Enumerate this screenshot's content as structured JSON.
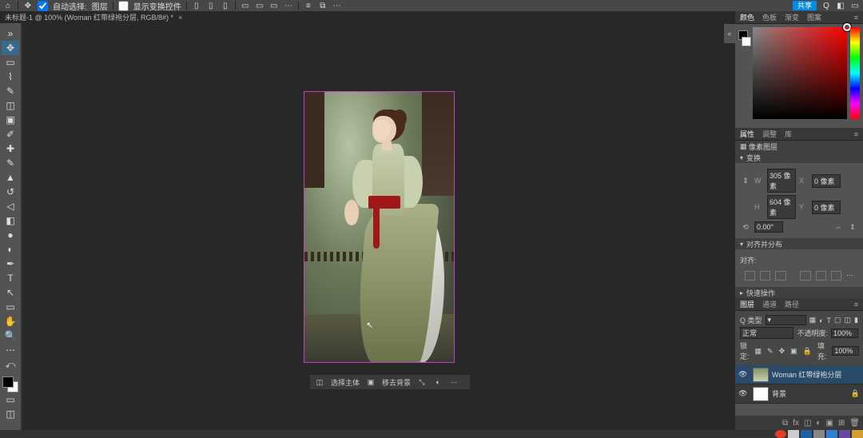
{
  "topbar": {
    "home_icon": "home",
    "auto_select_label": "自动选择:",
    "auto_select_value": "图层",
    "show_controls_label": "显示变换控件",
    "share_label": "共享"
  },
  "tab": {
    "title": "未标题-1 @ 100% (Woman 红带绿袍分层, RGB/8#) *",
    "close": "×"
  },
  "selbar": {
    "select_subject": "选择主体",
    "remove_bg": "移去背景"
  },
  "rightcol_toggle": "«",
  "color_panel": {
    "tabs": [
      "颜色",
      "色板",
      "渐变",
      "图案"
    ],
    "active": 0
  },
  "props_panel": {
    "tabs": [
      "属性",
      "调整",
      "库"
    ],
    "active": 0,
    "title_icon": "pixel-layer",
    "title": "像素图层",
    "section_transform": "变换",
    "w_label": "W",
    "w_value": "305 像素",
    "x_label": "X",
    "x_value": "0 像素",
    "h_label": "H",
    "h_value": "604 像素",
    "y_label": "Y",
    "y_value": "0 像素",
    "rotate_value": "0.00°",
    "section_align": "对齐并分布",
    "align_label": "对齐:",
    "section_more": "快速操作"
  },
  "layers_panel": {
    "tabs": [
      "图层",
      "通道",
      "路径"
    ],
    "active": 0,
    "kind_label": "Q 类型",
    "blend_label": "正常",
    "opacity_label": "不透明度:",
    "opacity_value": "100%",
    "lock_label": "锁定:",
    "fill_label": "填充:",
    "fill_value": "100%",
    "layers": [
      {
        "visible": true,
        "name": "Woman 红带绿袍分层",
        "selected": true,
        "thumb": "img"
      },
      {
        "visible": true,
        "name": "背景",
        "selected": false,
        "thumb": "white",
        "locked": true
      }
    ]
  }
}
